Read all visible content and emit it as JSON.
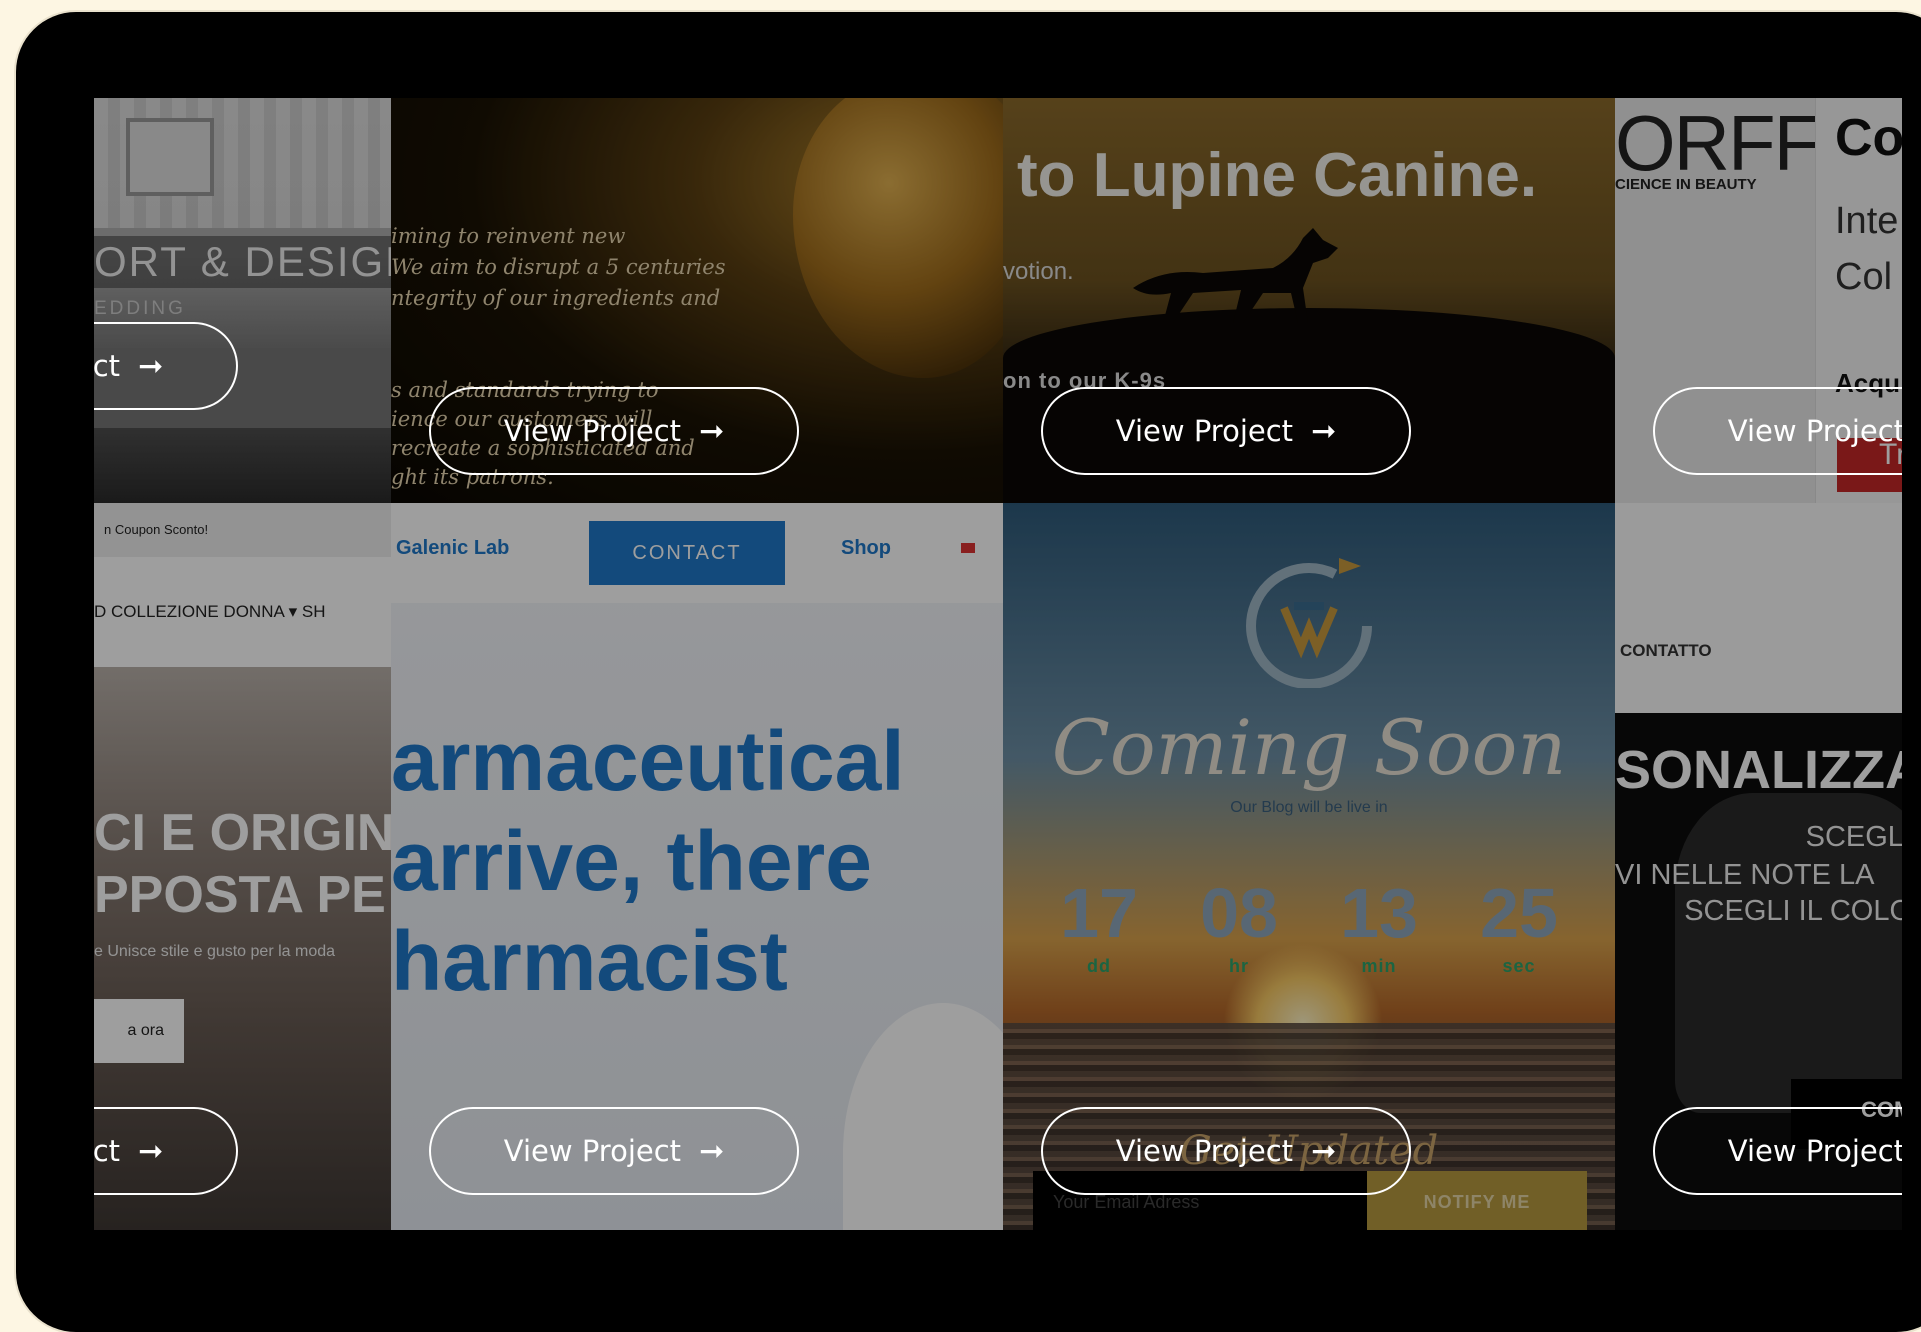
{
  "button_label": "View Project",
  "arrow_glyph": "➞",
  "tiles": {
    "comfort": {
      "title": "ORT & DESIGN",
      "subtitle": "EDDING"
    },
    "gold": {
      "lines": [
        "iming to reinvent new",
        "We aim to disrupt a 5 centuries",
        "ntegrity of our ingredients and",
        "s and standards trying to",
        "ience our customers will",
        "recreate a sophisticated and",
        "ght its patrons."
      ]
    },
    "lupine": {
      "title": "to Lupine Canine.",
      "line1": "votion.",
      "line2": "on to our K-9s"
    },
    "orff": {
      "logo": "ORFF",
      "tagline": "CIENCE IN BEAUTY",
      "heading": "Co",
      "line1": "Inte",
      "line2": "Col",
      "cta_heading": "Acqu",
      "red_button": "Tra"
    },
    "collezione": {
      "coupon": "n Coupon Sconto!",
      "nav": "D     COLLEZIONE DONNA ▾   SH",
      "heading1": "CI E ORIGIN",
      "heading2": "PPOSTA PE",
      "tagline": "e Unisce stile e gusto per la moda",
      "shop": "a ora"
    },
    "galenic": {
      "brand": "Galenic Lab",
      "contact": "CONTACT",
      "shop": "Shop",
      "headline": [
        "armaceutical",
        " arrive, there",
        "harmacist"
      ]
    },
    "coming": {
      "title": "Coming Soon",
      "small": "Our Blog will be live in",
      "countdown": [
        {
          "value": "17",
          "unit": "dd"
        },
        {
          "value": "08",
          "unit": "hr"
        },
        {
          "value": "13",
          "unit": "min"
        },
        {
          "value": "25",
          "unit": "sec"
        }
      ],
      "get_updated": "Get Updated",
      "email_placeholder": "Your Email Adress",
      "notify": "NOTIFY ME"
    },
    "personalizza": {
      "contatto": "CONTATTO",
      "heading": "SONALIZZA",
      "line1": "SCEGLI",
      "line2": "VI NELLE NOTE LA",
      "line3": "SCEGLI IL COLO",
      "button": "COMI"
    }
  },
  "colors": {
    "frame": "#000000",
    "background": "#fdf6e3",
    "galenic_blue": "#1f78c8",
    "countdown_green": "#2ca36b",
    "notify_gold": "#b7993f"
  }
}
